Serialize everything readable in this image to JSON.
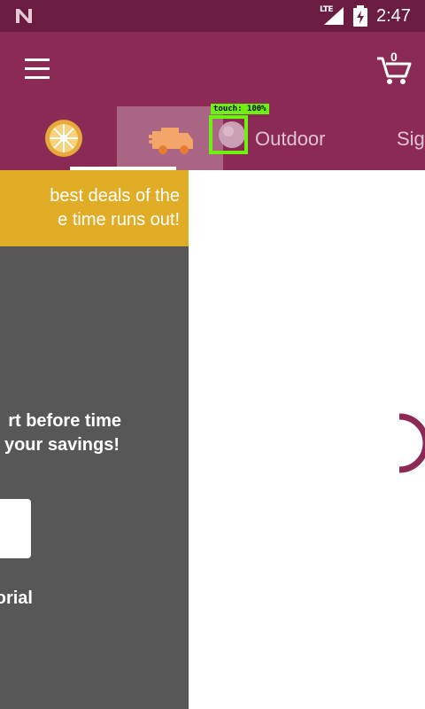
{
  "status_bar": {
    "time": "2:47",
    "network": "LTE",
    "icons": [
      "n-logo-icon",
      "signal-icon",
      "battery-charging-icon"
    ]
  },
  "app_bar": {
    "menu_icon": "hamburger-menu-icon",
    "cart_icon": "shopping-cart-icon",
    "cart_count": "0"
  },
  "tabs": {
    "items": [
      {
        "icon": "deals-badge-icon",
        "label": ""
      },
      {
        "icon": "delivery-truck-icon",
        "label": ""
      },
      {
        "icon": "outdoor-icon",
        "label": "Outdoor"
      },
      {
        "icon": "",
        "label": "Sig"
      }
    ],
    "selected_index": 1
  },
  "touch_overlay": {
    "label": "touch: 100%",
    "color": "#6bf20f"
  },
  "left_panel": {
    "banner_line1": "best deals of the",
    "banner_line2": "e time runs out!",
    "message_line1": "rt before time",
    "message_line2": "your savings!",
    "tutorial_link": "orial"
  },
  "colors": {
    "status_bar": "#6a1d40",
    "app_bar": "#8a2a55",
    "banner": "#e1ad27",
    "panel": "#575757",
    "spinner": "#8a2a55"
  }
}
